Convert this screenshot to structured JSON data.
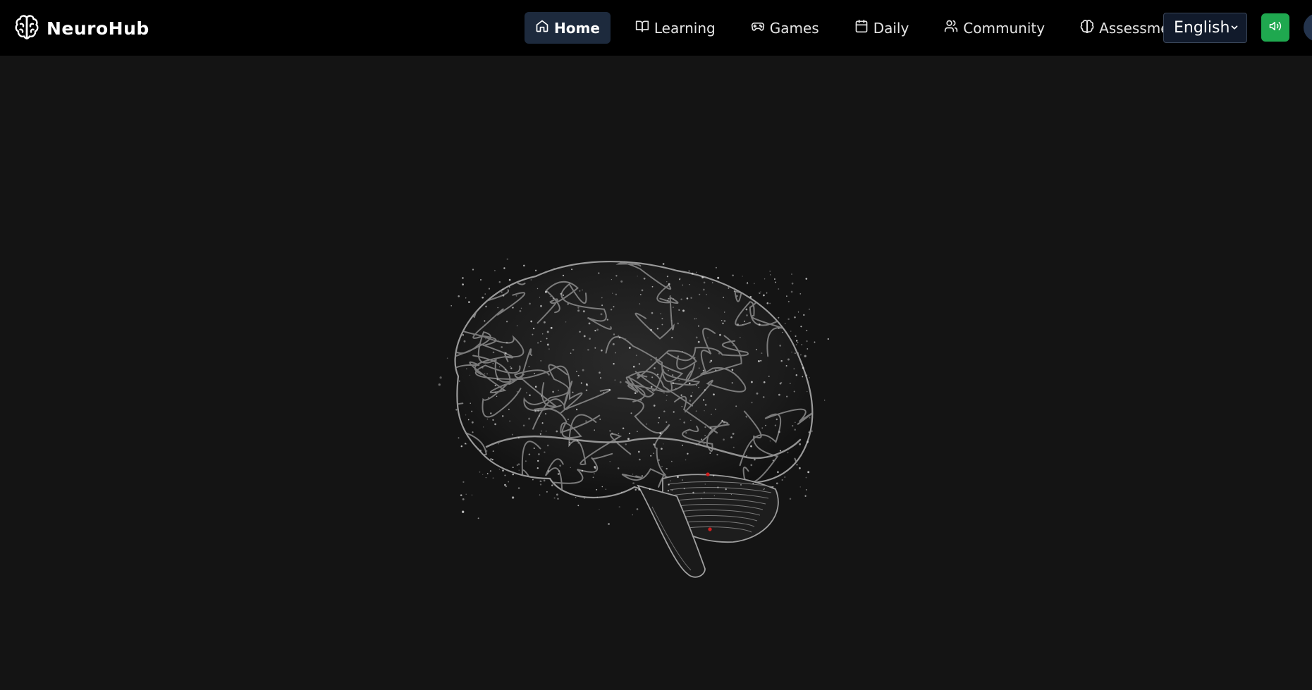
{
  "app": {
    "name": "NeuroHub",
    "logo_icon": "brain-icon"
  },
  "nav": {
    "items": [
      {
        "label": "Home",
        "icon": "home-icon",
        "active": true
      },
      {
        "label": "Learning",
        "icon": "book-open-icon",
        "active": false
      },
      {
        "label": "Games",
        "icon": "gamepad-icon",
        "active": false
      },
      {
        "label": "Daily",
        "icon": "calendar-icon",
        "active": false
      },
      {
        "label": "Community",
        "icon": "users-icon",
        "active": false
      },
      {
        "label": "Assessment",
        "icon": "brain-icon",
        "active": false
      }
    ]
  },
  "language": {
    "selected": "English"
  },
  "sound": {
    "icon": "speaker-icon",
    "state": "on"
  },
  "colors": {
    "background": "#141414",
    "header": "#000000",
    "active_nav": "#1d2a3d",
    "sound_button": "#1fa84f",
    "highlight_dots": "#d11f1f"
  },
  "hero": {
    "visual": "3D brain point cloud"
  }
}
